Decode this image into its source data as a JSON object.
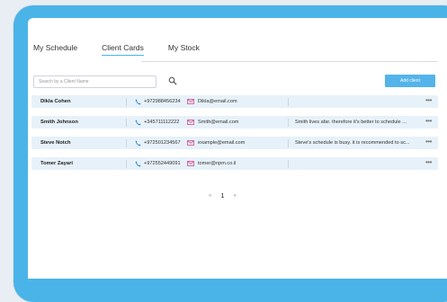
{
  "tabs": [
    {
      "label": "My Schedule"
    },
    {
      "label": "Client Cards"
    },
    {
      "label": "My Stock"
    }
  ],
  "active_tab": "Client Cards",
  "search": {
    "placeholder": "Search by a Client Name"
  },
  "add_button": {
    "label": "Add client"
  },
  "clients": [
    {
      "name": "Dikla Cohen",
      "phone": "+972988456234",
      "email": "Dikla@email.com",
      "note": ""
    },
    {
      "name": "Smith Johnson",
      "phone": "+345711112222",
      "email": "Smith@email.com",
      "note": "Smith lives afar. therefore it's better to schedule ..."
    },
    {
      "name": "Steve Notch",
      "phone": "+972501234567",
      "email": "example@email.com",
      "note": "Steve's schedule is busy. it is recommended to sc..."
    },
    {
      "name": "Tomer Zayari",
      "phone": "+972552449091",
      "email": "tomer@npm.co.il",
      "note": ""
    }
  ],
  "row_more_label": "•••",
  "pagination": {
    "prev": "«",
    "current": "1",
    "next": "»"
  },
  "colors": {
    "device_frame": "#4ab4e8",
    "accent": "#53b4ea",
    "row_background": "#e7f1f9",
    "phone_icon": "#2a8bd0",
    "mail_icon": "#d65a9a"
  },
  "icons": {
    "search": "search-icon",
    "phone": "phone-icon",
    "mail": "mail-icon",
    "more": "more-options-icon"
  }
}
